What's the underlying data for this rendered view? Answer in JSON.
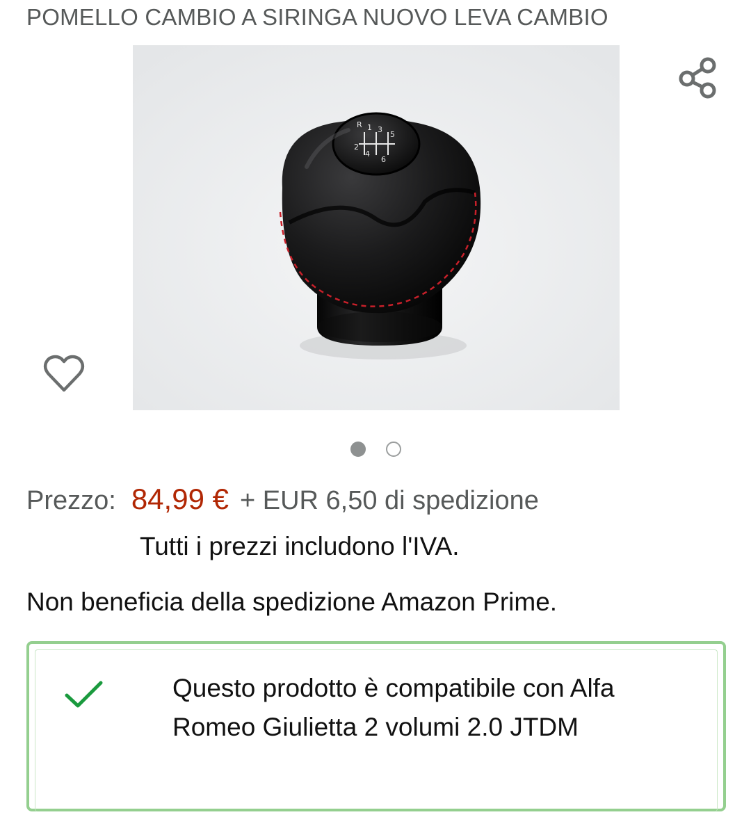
{
  "product": {
    "title": "POMELLO CAMBIO A SIRINGA NUOVO LEVA CAMBIO",
    "image_alt": "Pomello cambio in pelle nera con cuciture rosse",
    "gear_digits": [
      "R",
      "1",
      "3",
      "5",
      "2",
      "4",
      "6"
    ]
  },
  "actions": {
    "share_icon": "share-icon",
    "wishlist_icon": "heart-icon"
  },
  "carousel": {
    "image_count": 2,
    "active_index": 0
  },
  "pricing": {
    "label": "Prezzo:",
    "price": "84,99 €",
    "shipping": "+ EUR 6,50 di spedizione",
    "vat_note": "Tutti i prezzi includono l'IVA."
  },
  "prime_note": "Non beneficia della spedizione Amazon Prime.",
  "compatibility": {
    "icon": "checkmark-icon",
    "text": "Questo prodotto è compatibile con Alfa Romeo Giulietta 2 volumi 2.0 JTDM",
    "border_color": "#94cf8f",
    "check_color": "#1a9a3e"
  },
  "colors": {
    "price": "#b12704",
    "secondary_text": "#565959"
  }
}
